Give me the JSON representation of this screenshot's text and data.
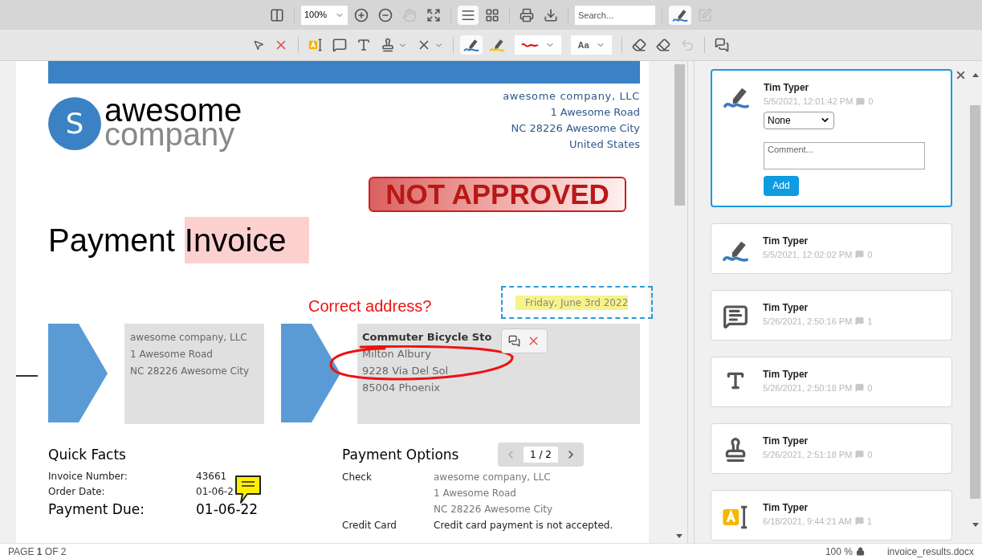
{
  "top_toolbar": {
    "items": [
      {
        "kind": "panel",
        "active": false,
        "disabled": false
      },
      {
        "kind": "separator"
      },
      {
        "kind": "zoom",
        "value": "100%"
      },
      {
        "kind": "zoom-in",
        "active": false,
        "disabled": false
      },
      {
        "kind": "zoom-out",
        "active": false,
        "disabled": false
      },
      {
        "kind": "hand",
        "active": false,
        "disabled": true
      },
      {
        "kind": "fit",
        "active": false,
        "disabled": false
      },
      {
        "kind": "separator"
      },
      {
        "kind": "single-page",
        "active": true,
        "disabled": false
      },
      {
        "kind": "grid",
        "active": false,
        "disabled": false
      },
      {
        "kind": "separator"
      },
      {
        "kind": "print",
        "active": false,
        "disabled": false
      },
      {
        "kind": "download",
        "active": false,
        "disabled": false
      },
      {
        "kind": "separator"
      },
      {
        "kind": "search",
        "placeholder": "Search..."
      },
      {
        "kind": "separator"
      },
      {
        "kind": "ink",
        "active": true,
        "disabled": false
      },
      {
        "kind": "edit",
        "active": false,
        "disabled": true
      }
    ]
  },
  "annotation_toolbar": {
    "items": [
      {
        "kind": "pointer",
        "active": false,
        "disabled": false
      },
      {
        "kind": "delete",
        "active": false,
        "disabled": false
      },
      {
        "kind": "separator"
      },
      {
        "kind": "text-highlight",
        "active": false,
        "disabled": false
      },
      {
        "kind": "comment",
        "active": false,
        "disabled": false
      },
      {
        "kind": "text",
        "active": false,
        "disabled": false
      },
      {
        "kind": "stamp",
        "active": false,
        "disabled": false
      },
      {
        "kind": "redact",
        "active": false,
        "disabled": false
      },
      {
        "kind": "separator"
      },
      {
        "kind": "ink",
        "active": true,
        "disabled": false
      },
      {
        "kind": "highlighter",
        "active": false,
        "disabled": false
      },
      {
        "kind": "line-color"
      },
      {
        "kind": "font",
        "label": "Aa"
      },
      {
        "kind": "separator"
      },
      {
        "kind": "eraser",
        "active": false,
        "disabled": false
      },
      {
        "kind": "eraser-lines",
        "active": false,
        "disabled": false
      },
      {
        "kind": "undo",
        "active": false,
        "disabled": true
      },
      {
        "kind": "separator"
      },
      {
        "kind": "comments",
        "active": false,
        "disabled": false
      }
    ]
  },
  "document": {
    "logo": {
      "mark": "S",
      "line_1": "awesome",
      "line_2": "company"
    },
    "sender_address": [
      "awesome company, LLC",
      "1 Awesome Road",
      "NC 28226 Awesome City",
      "United States"
    ],
    "stamp": "NOT APPROVED",
    "title": "Payment",
    "title_highlighted": "Invoice",
    "free_text": "Correct address?",
    "date": "Friday, June 3rd 2022",
    "from_block": [
      "awesome company, LLC",
      "1 Awesome Road",
      "NC 28226 Awesome City"
    ],
    "to_block": [
      "Commuter Bicycle Sto",
      "Milton Albury",
      "9228 Via Del Sol",
      "85004 Phoenix"
    ],
    "quick_facts": {
      "heading": "Quick Facts",
      "rows": [
        {
          "label": "Invoice Number:",
          "value": "43661",
          "large": false
        },
        {
          "label": "Order Date:",
          "value": "01-06-2",
          "large": false
        },
        {
          "label": "Payment Due:",
          "value": "01-06-22",
          "large": true
        }
      ]
    },
    "payment_options": {
      "heading": "Payment Options",
      "rows": [
        {
          "label": "Check",
          "lines": [
            "awesome company, LLC",
            "1 Awesome Road",
            "NC 28226 Awesome City"
          ],
          "muted": true
        },
        {
          "label": "Credit Card",
          "lines": [
            "Credit card payment is not accepted."
          ],
          "muted": false
        }
      ]
    },
    "pager": {
      "text": "1 / 2",
      "prev_disabled": true,
      "next_disabled": false
    }
  },
  "comments_panel": {
    "cards": [
      {
        "kind": "ink",
        "author": "Tim Typer",
        "time": "5/5/2021, 12:01:42 PM",
        "replies": "0",
        "selected": true,
        "status": "None",
        "comment_placeholder": "Comment...",
        "add_label": "Add"
      },
      {
        "kind": "ink",
        "author": "Tim Typer",
        "time": "5/5/2021, 12:02:02 PM",
        "replies": "0",
        "selected": false
      },
      {
        "kind": "comment",
        "author": "Tim Typer",
        "time": "5/26/2021, 2:50:16 PM",
        "replies": "1",
        "selected": false
      },
      {
        "kind": "text",
        "author": "Tim Typer",
        "time": "5/26/2021, 2:50:18 PM",
        "replies": "0",
        "selected": false
      },
      {
        "kind": "stamp",
        "author": "Tim Typer",
        "time": "5/26/2021, 2:51:18 PM",
        "replies": "0",
        "selected": false
      },
      {
        "kind": "highlight",
        "author": "Tim Typer",
        "time": "6/18/2021, 9:44:21 AM",
        "replies": "1",
        "selected": false
      }
    ]
  },
  "status_bar": {
    "page": "PAGE **1** OF 2",
    "zoom": "100 %",
    "file": "invoice_results.docx"
  }
}
